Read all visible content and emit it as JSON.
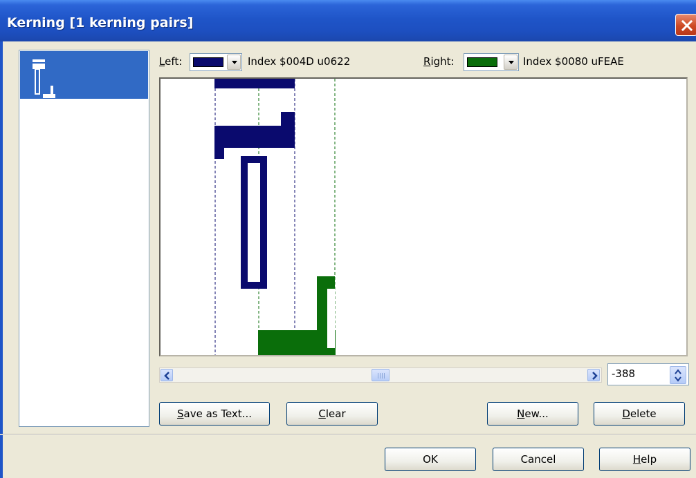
{
  "window": {
    "title": "Kerning [1 kerning pairs]"
  },
  "header": {
    "left_label_pre": "",
    "left_label_hot": "L",
    "left_label_post": "eft:",
    "left_color": "#0a0a6e",
    "left_index": "Index $004D u0622",
    "right_label_hot": "R",
    "right_label_post": "ight:",
    "right_color": "#0a6e0a",
    "right_index": "Index $0080 uFEAE"
  },
  "kerning": {
    "value": "-388"
  },
  "buttons": {
    "save_as_text": {
      "hot": "S",
      "rest": "ave as Text..."
    },
    "clear": {
      "hot": "C",
      "rest": "lear"
    },
    "new": {
      "hot": "N",
      "rest": "ew..."
    },
    "delete": {
      "hot": "D",
      "rest": "elete"
    },
    "ok": "OK",
    "cancel": "Cancel",
    "help": {
      "hot": "H",
      "rest": "elp"
    }
  },
  "colors": {
    "title_bar": "#1f55c8",
    "selection": "#316ac5",
    "left_glyph": "#0a0a6e",
    "right_glyph": "#0a6e0a",
    "dialog_bg": "#ece9d8"
  },
  "icons": [
    "close-icon",
    "scroll-left-icon",
    "scroll-right-icon",
    "spin-up-icon",
    "spin-down-icon",
    "dropdown-arrow-icon"
  ]
}
